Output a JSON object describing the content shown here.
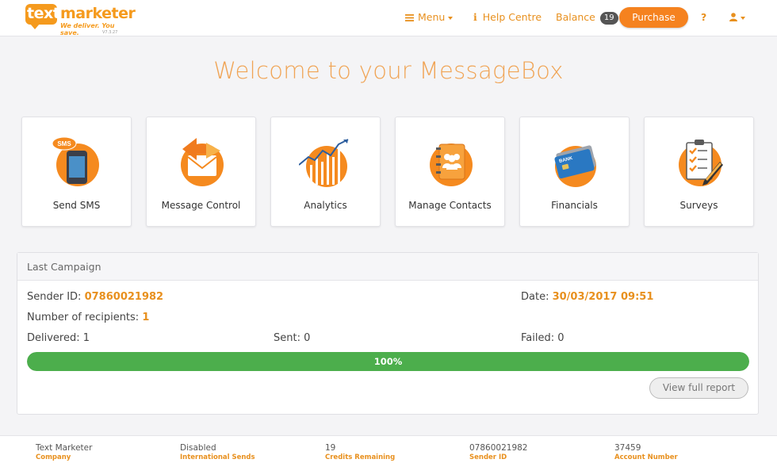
{
  "brand": {
    "logo_word1": "text",
    "logo_word2": "marketer",
    "tagline": "We deliver. You save.",
    "version": "V7.3.27",
    "accent_color": "#f5821f"
  },
  "nav": {
    "menu_label": "Menu",
    "help_label": "Help Centre",
    "balance_label": "Balance",
    "balance_value": "19",
    "purchase_label": "Purchase",
    "help_q": "?",
    "user_icon": "user-icon"
  },
  "page": {
    "title": "Welcome to your MessageBox"
  },
  "tiles": [
    {
      "label": "Send SMS",
      "icon": "phone-sms-icon",
      "bubble": "SMS"
    },
    {
      "label": "Message Control",
      "icon": "envelope-arrow-icon"
    },
    {
      "label": "Analytics",
      "icon": "analytics-chart-icon"
    },
    {
      "label": "Manage Contacts",
      "icon": "contacts-book-icon"
    },
    {
      "label": "Financials",
      "icon": "bank-card-icon",
      "card_text": "BANK"
    },
    {
      "label": "Surveys",
      "icon": "clipboard-check-icon"
    }
  ],
  "campaign": {
    "heading": "Last Campaign",
    "sender_label": "Sender ID:",
    "sender_value": "07860021982",
    "date_label": "Date:",
    "date_value": "30/03/2017 09:51",
    "recipients_label": "Number of recipients:",
    "recipients_value": "1",
    "delivered_label": "Delivered:",
    "delivered_value": "1",
    "sent_label": "Sent:",
    "sent_value": "0",
    "failed_label": "Failed:",
    "failed_value": "0",
    "progress_text": "100%",
    "progress_fraction": 1.0,
    "report_button": "View full report"
  },
  "footer": [
    {
      "value": "Text Marketer",
      "label": "Company"
    },
    {
      "value": "Disabled",
      "label": "International Sends"
    },
    {
      "value": "19",
      "label": "Credits Remaining"
    },
    {
      "value": "07860021982",
      "label": "Sender ID"
    },
    {
      "value": "37459",
      "label": "Account Number"
    }
  ]
}
